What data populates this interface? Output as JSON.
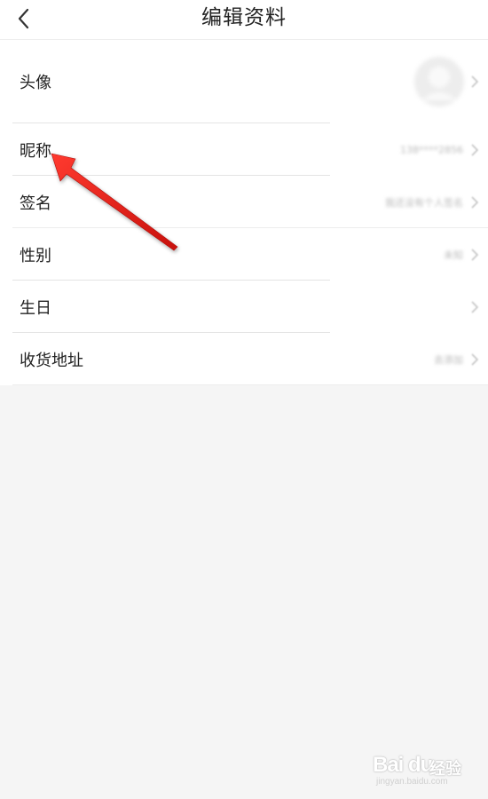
{
  "header": {
    "title": "编辑资料",
    "back_icon": "chevron-left-icon"
  },
  "rows": [
    {
      "label": "头像",
      "value": ""
    },
    {
      "label": "昵称",
      "value": "138****2856"
    },
    {
      "label": "签名",
      "value": "我还没有个人签名"
    },
    {
      "label": "性别",
      "value": "未知"
    },
    {
      "label": "生日",
      "value": ""
    },
    {
      "label": "收货地址",
      "value": "去添加"
    }
  ],
  "annotation": {
    "type": "red-arrow",
    "color": "#e8231f"
  },
  "watermark": {
    "logo": "Bai du",
    "cn": "经验",
    "url": "jingyan.baidu.com"
  }
}
